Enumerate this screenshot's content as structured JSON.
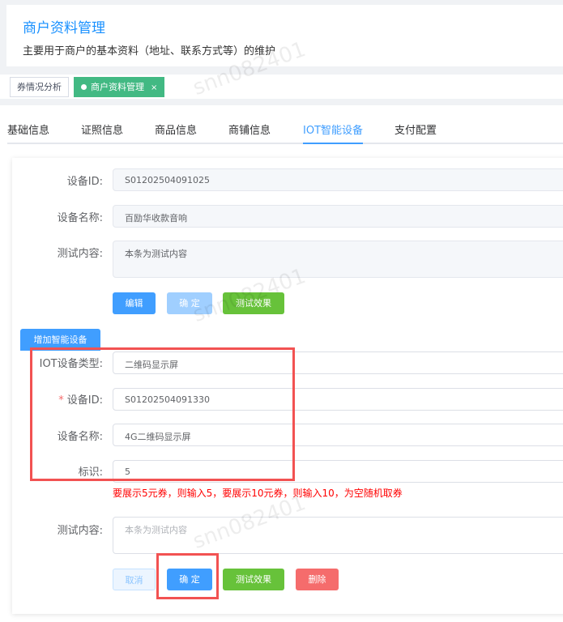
{
  "header": {
    "title": "商户资料管理",
    "description": "主要用于商户的基本资料（地址、联系方式等）的维护"
  },
  "tags": [
    {
      "label": "券情况分析"
    },
    {
      "label": "商户资料管理",
      "close": "×"
    }
  ],
  "tabs": [
    "基础信息",
    "证照信息",
    "商品信息",
    "商铺信息",
    "IOT智能设备",
    "支付配置"
  ],
  "device1": {
    "id_label": "设备ID:",
    "id": "S01202504091025",
    "name_label": "设备名称:",
    "name": "百励华收款音响",
    "content_label": "测试内容:",
    "content": "本条为测试内容",
    "edit": "编辑",
    "confirm": "确 定",
    "test": "测试效果"
  },
  "add_button": "增加智能设备",
  "device2": {
    "type_label": "IOT设备类型:",
    "type": "二维码显示屏",
    "required": "*",
    "id_label": "设备ID:",
    "id": "S01202504091330",
    "name_label": "设备名称:",
    "name": "4G二维码显示屏",
    "mark_label": "标识:",
    "mark": "5",
    "hint": "要展示5元券，则输入5，要展示10元券，则输入10，为空随机取券",
    "content_label": "测试内容:",
    "content_placeholder": "本条为测试内容",
    "cancel": "取消",
    "confirm": "确 定",
    "test": "测试效果",
    "delete": "删除"
  },
  "watermark": "snn082401",
  "colors": {
    "primary": "#409eff",
    "success": "#67c23a",
    "danger": "#f56c6c",
    "highlight": "#f25252"
  }
}
